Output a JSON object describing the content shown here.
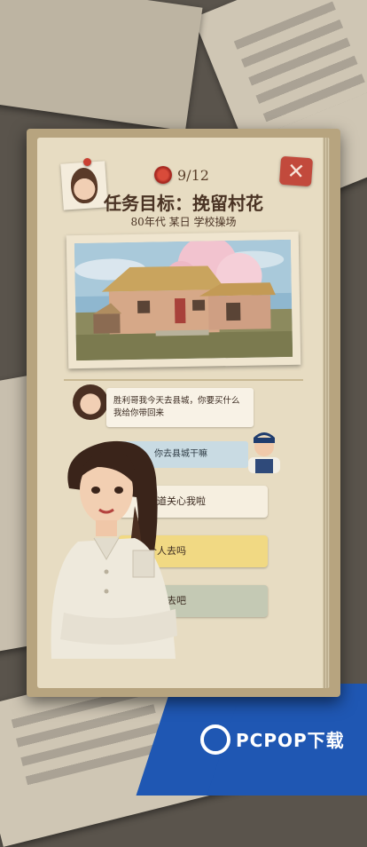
{
  "task": {
    "progress": "9/12",
    "title": "任务目标：挽留村花",
    "subtitle": "80年代   某日   学校操场",
    "close_icon": "close-x"
  },
  "dialogue": {
    "girl_line": "胜利哥我今天去县城，你要买什么我给你带回来",
    "man_line": "你去县城干嘛"
  },
  "options": [
    {
      "label": "知道关心我啦"
    },
    {
      "label": "个人去吗"
    },
    {
      "label": "陪你去吧"
    }
  ],
  "watermark": {
    "text": "PCPOP下载"
  },
  "colors": {
    "card": "#e7dcc2",
    "option_selected": "#f1d983",
    "man_bubble": "#c9dbe3",
    "close": "#c24a3c",
    "corner": "#1f57b3"
  }
}
